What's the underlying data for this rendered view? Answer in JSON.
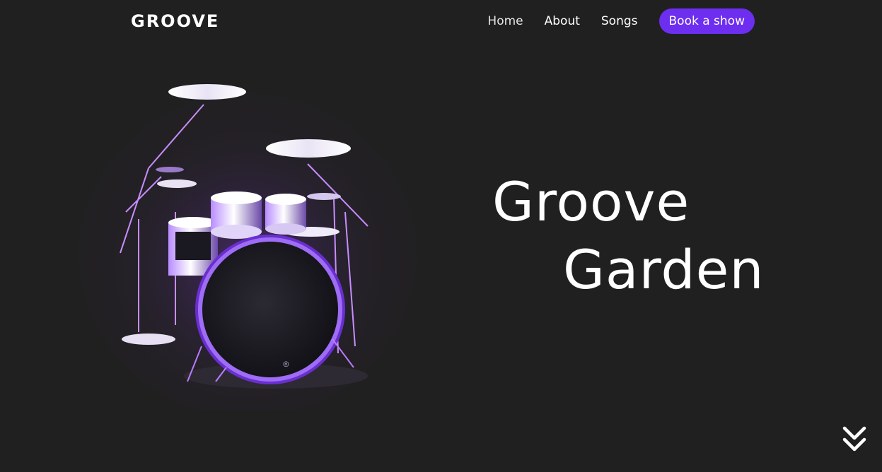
{
  "brand": {
    "name": "GROOVE"
  },
  "nav": {
    "items": [
      {
        "label": "Home"
      },
      {
        "label": "About"
      },
      {
        "label": "Songs"
      }
    ],
    "cta_label": "Book a show"
  },
  "hero": {
    "title_line1": "Groove",
    "title_line2": "Garden",
    "image_subject": "drum-kit",
    "scroll_icon": "double-chevron-down-icon"
  },
  "colors": {
    "background": "#212021",
    "accent": "#6d2ef0",
    "glow": "#8a3cff",
    "text": "#ffffff"
  }
}
